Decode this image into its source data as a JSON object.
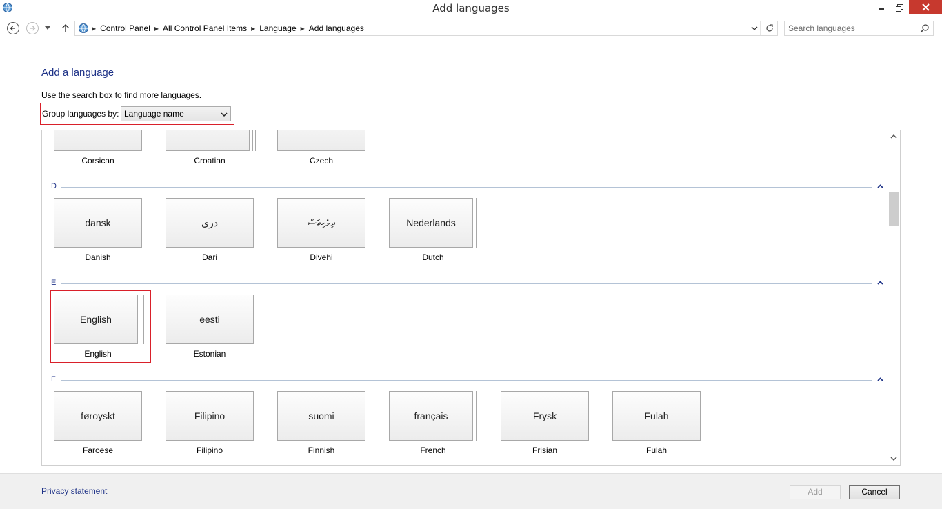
{
  "window": {
    "title": "Add languages"
  },
  "nav": {
    "breadcrumbs": [
      "Control Panel",
      "All Control Panel Items",
      "Language",
      "Add languages"
    ],
    "search_placeholder": "Search languages"
  },
  "main": {
    "heading": "Add a language",
    "hint": "Use the search box to find more languages.",
    "group_by_label": "Group languages by:",
    "group_by_value": "Language name"
  },
  "groups": [
    {
      "letter": "D"
    },
    {
      "letter": "E"
    },
    {
      "letter": "F"
    }
  ],
  "tiles": {
    "c_row": [
      {
        "native": "",
        "name": "Corsican"
      },
      {
        "native": "",
        "name": "Croatian"
      },
      {
        "native": "",
        "name": "Czech"
      }
    ],
    "d_row": [
      {
        "native": "dansk",
        "name": "Danish"
      },
      {
        "native": "دری",
        "name": "Dari"
      },
      {
        "native": "ދިވެހިބަސް",
        "name": "Divehi"
      },
      {
        "native": "Nederlands",
        "name": "Dutch"
      }
    ],
    "e_row": [
      {
        "native": "English",
        "name": "English"
      },
      {
        "native": "eesti",
        "name": "Estonian"
      }
    ],
    "f_row": [
      {
        "native": "føroyskt",
        "name": "Faroese"
      },
      {
        "native": "Filipino",
        "name": "Filipino"
      },
      {
        "native": "suomi",
        "name": "Finnish"
      },
      {
        "native": "français",
        "name": "French"
      },
      {
        "native": "Frysk",
        "name": "Frisian"
      },
      {
        "native": "Fulah",
        "name": "Fulah"
      }
    ]
  },
  "footer": {
    "privacy": "Privacy statement",
    "add": "Add",
    "cancel": "Cancel"
  }
}
